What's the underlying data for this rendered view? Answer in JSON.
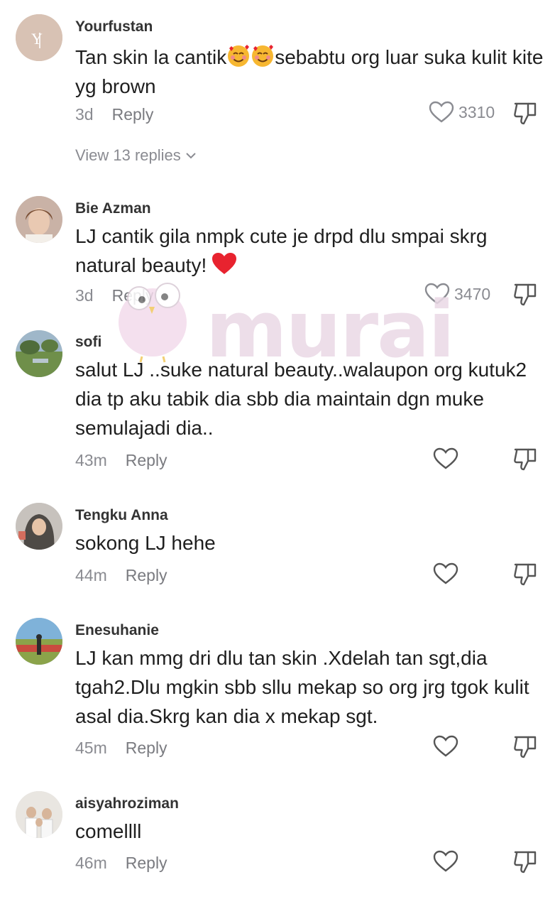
{
  "comments": [
    {
      "username": "Yourfustan",
      "text_before": "Tan skin la cantik",
      "text_after": "sebabtu org luar suka kulit kite yg brown",
      "time": "3d",
      "reply_label": "Reply",
      "likes": "3310",
      "view_replies": "View 13 replies",
      "avatar": "yourfustan-logo-avatar"
    },
    {
      "username": "Bie Azman",
      "text": "LJ cantik gila nmpk cute je drpd dlu smpai skrg natural beauty!",
      "time": "3d",
      "reply_label": "Reply",
      "likes": "3470",
      "avatar": "woman-portrait-avatar"
    },
    {
      "username": "sofi",
      "text": "salut LJ ..suke natural beauty..walaupon org kutuk2 dia tp aku tabik dia sbb dia maintain dgn muke semulajadi dia..",
      "time": "43m",
      "reply_label": "Reply",
      "avatar": "landscape-avatar"
    },
    {
      "username": "Tengku Anna",
      "text": "sokong LJ hehe",
      "time": "44m",
      "reply_label": "Reply",
      "avatar": "hijab-woman-avatar"
    },
    {
      "username": "Enesuhanie",
      "text": "LJ kan mmg dri dlu tan skin .Xdelah tan sgt,dia tgah2.Dlu mgkin sbb sllu mekap so org jrg tgok kulit asal dia.Skrg kan dia x mekap sgt.",
      "time": "45m",
      "reply_label": "Reply",
      "avatar": "outdoor-field-avatar"
    },
    {
      "username": "aisyahroziman",
      "text": "comellll",
      "time": "46m",
      "reply_label": "Reply",
      "avatar": "family-photo-avatar"
    }
  ],
  "watermark": {
    "text": "murai"
  },
  "icons": {
    "like": "heart-outline-icon",
    "dislike": "thumbs-down-icon",
    "chevron": "chevron-down-icon",
    "emoji": "smiling-face-with-hearts-emoji",
    "heart": "red-heart-emoji"
  },
  "colors": {
    "text": "#1f1f1f",
    "meta": "#8a8b91",
    "heart": "#e8232f",
    "watermark": "#ead9e6"
  }
}
